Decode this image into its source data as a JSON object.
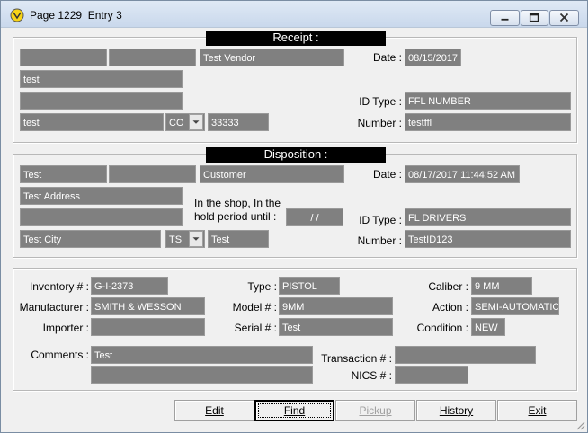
{
  "window": {
    "title": "Page 1229  Entry 3",
    "icon": "yellow-circle-app-icon",
    "controls": {
      "minimize": "minimize-icon",
      "maximize": "maximize-icon",
      "close": "close-icon"
    }
  },
  "receipt": {
    "header": "Receipt :",
    "name_field_1": "",
    "name_field_2": "",
    "vendor": "Test Vendor",
    "address_1": "test",
    "address_2": "",
    "city": "test",
    "state": "CO",
    "zip": "33333",
    "date_label": "Date :",
    "date": "08/15/2017",
    "id_type_label": "ID Type :",
    "id_type": "FFL NUMBER",
    "number_label": "Number :",
    "number": "testffl"
  },
  "disposition": {
    "header": "Disposition :",
    "first_name": "Test",
    "last_name": "",
    "customer": "Customer",
    "address_1": "Test Address",
    "address_2": "",
    "shop_label_line1": "In the shop, In the",
    "shop_label_line2": "hold period until :",
    "hold_until": "/ /",
    "city": "Test City",
    "state": "TS",
    "zip": "Test",
    "date_label": "Date :",
    "date": "08/17/2017 11:44:52 AM",
    "id_type_label": "ID Type :",
    "id_type": "FL DRIVERS",
    "number_label": "Number :",
    "number": "TestID123"
  },
  "item": {
    "inventory_label": "Inventory # :",
    "inventory": "G-I-2373",
    "manufacturer_label": "Manufacturer :",
    "manufacturer": "SMITH & WESSON",
    "importer_label": "Importer :",
    "importer": "",
    "type_label": "Type :",
    "type": "PISTOL",
    "model_label": "Model # :",
    "model": "9MM",
    "serial_label": "Serial # :",
    "serial": "Test",
    "caliber_label": "Caliber :",
    "caliber": "9 MM",
    "action_label": "Action :",
    "action": "SEMI-AUTOMATIC",
    "condition_label": "Condition :",
    "condition": "NEW",
    "comments_label": "Comments :",
    "comments_1": "Test",
    "comments_2": "",
    "transaction_label": "Transaction # :",
    "transaction": "",
    "nics_label": "NICS # :",
    "nics": ""
  },
  "buttons": {
    "edit": "Edit",
    "find": "Find",
    "pickup": "Pickup",
    "history": "History",
    "exit": "Exit"
  },
  "colors": {
    "field_bg": "#808080",
    "field_text": "#ffffff",
    "header_bg": "#000000",
    "window_bg": "#f0f0f0"
  }
}
